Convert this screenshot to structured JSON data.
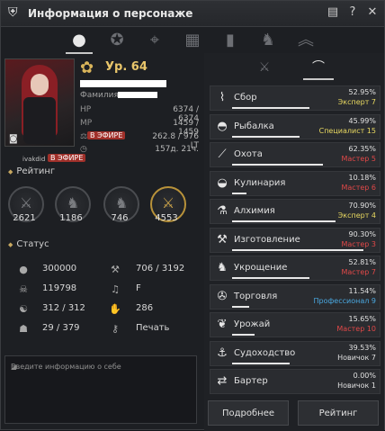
{
  "window": {
    "title": "Информация о персонаже"
  },
  "title_icons": [
    "document-icon",
    "help-icon",
    "close-icon"
  ],
  "tabs": [
    "person-icon",
    "medal-icon",
    "telescope-icon",
    "gift-icon",
    "chart-icon",
    "horse-icon",
    "chevron-up-icon"
  ],
  "character": {
    "level": "Ур. 64",
    "family_label": "Фамилия:"
  },
  "stats": [
    {
      "label": "HP",
      "value": "6374 / 6374"
    },
    {
      "label": "MP",
      "value": "1459 / 1459"
    },
    {
      "label": "",
      "value": "262.8 / 976 LT"
    },
    {
      "label": "",
      "value": "157д. 21ч."
    }
  ],
  "badges": {
    "badge1": "В ЭФИРЕ",
    "badge2": "В ЭФИРЕ",
    "guild": "ivakdid"
  },
  "rating": {
    "title": "Рейтинг",
    "values": [
      "2621",
      "1186",
      "746",
      "4553"
    ]
  },
  "status": {
    "title": "Статус",
    "items": [
      {
        "icon": "coins-icon",
        "value": "300000"
      },
      {
        "icon": "scales-icon",
        "value": "706 / 3192"
      },
      {
        "icon": "skull-icon",
        "value": "119798"
      },
      {
        "icon": "music-icon",
        "value": "F"
      },
      {
        "icon": "hands-icon",
        "value": "312 / 312"
      },
      {
        "icon": "hand-icon",
        "value": "286"
      },
      {
        "icon": "bag-icon",
        "value": "29 / 379"
      },
      {
        "icon": "key-icon",
        "value": "Печать"
      }
    ]
  },
  "about": {
    "placeholder": "Введите информацию о себе"
  },
  "life_skills": [
    {
      "icon": "sickle-icon",
      "name": "Сбор",
      "percent": "52.95%",
      "grade": "Эксперт 7",
      "grade_color": "#e8d860",
      "progress": 52.95
    },
    {
      "icon": "fish-icon",
      "name": "Рыбалка",
      "percent": "45.99%",
      "grade": "Специалист 15",
      "grade_color": "#e8d860",
      "progress": 45.99
    },
    {
      "icon": "knife-icon",
      "name": "Охота",
      "percent": "62.35%",
      "grade": "Мастер 5",
      "grade_color": "#e04848",
      "progress": 62.35
    },
    {
      "icon": "pot-icon",
      "name": "Кулинария",
      "percent": "10.18%",
      "grade": "Мастер 6",
      "grade_color": "#e04848",
      "progress": 10.18
    },
    {
      "icon": "flask-icon",
      "name": "Алхимия",
      "percent": "70.90%",
      "grade": "Эксперт 4",
      "grade_color": "#e8d860",
      "progress": 70.9
    },
    {
      "icon": "hammer-icon",
      "name": "Изготовление",
      "percent": "90.30%",
      "grade": "Мастер 3",
      "grade_color": "#e04848",
      "progress": 90.3
    },
    {
      "icon": "horse-head-icon",
      "name": "Укрощение",
      "percent": "52.81%",
      "grade": "Мастер 7",
      "grade_color": "#e04848",
      "progress": 52.81
    },
    {
      "icon": "wheel-icon",
      "name": "Торговля",
      "percent": "11.54%",
      "grade": "Профессионал 9",
      "grade_color": "#4aa8e0",
      "progress": 11.54
    },
    {
      "icon": "sprout-icon",
      "name": "Урожай",
      "percent": "15.65%",
      "grade": "Мастер 10",
      "grade_color": "#e04848",
      "progress": 15.65
    },
    {
      "icon": "anchor-icon",
      "name": "Судоходство",
      "percent": "39.53%",
      "grade": "Новичок 7",
      "grade_color": "#e0e0e0",
      "progress": 39.53
    },
    {
      "icon": "arrows-icon",
      "name": "Бартер",
      "percent": "0.00%",
      "grade": "Новичок 1",
      "grade_color": "#e0e0e0",
      "progress": 0
    }
  ],
  "buttons": {
    "details": "Подробнее",
    "rating": "Рейтинг"
  }
}
